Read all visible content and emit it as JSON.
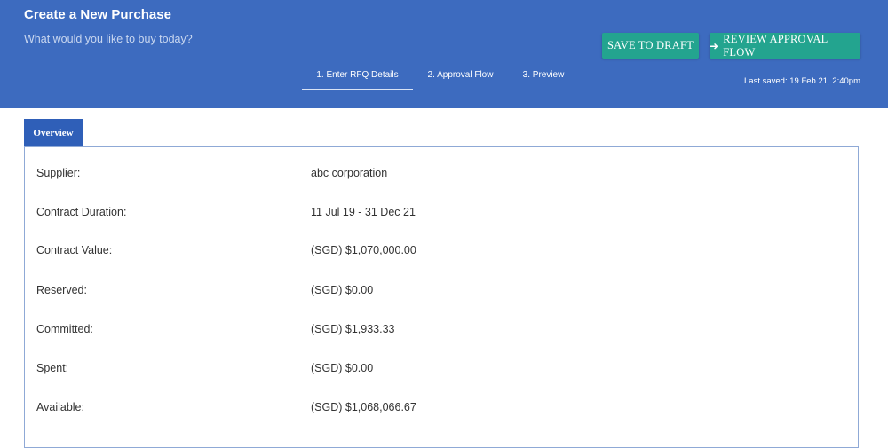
{
  "header": {
    "title": "Create a New Purchase",
    "subtitle": "What would you like to buy today?",
    "save_draft_label": "SAVE TO DRAFT",
    "review_label": "REVIEW APPROVAL FLOW",
    "review_icon": "arrow-right-icon",
    "last_saved": "Last saved: 19 Feb 21, 2:40pm",
    "accent_color": "#3d6bbf",
    "button_color": "#23a48f"
  },
  "steps": [
    {
      "label": "1. Enter RFQ Details",
      "active": true
    },
    {
      "label": "2. Approval Flow",
      "active": false
    },
    {
      "label": "3. Preview",
      "active": false
    }
  ],
  "tabs": {
    "overview": "Overview"
  },
  "overview": {
    "rows": [
      {
        "label": "Supplier:",
        "value": "abc corporation"
      },
      {
        "label": "Contract Duration:",
        "value": "11 Jul 19 - 31 Dec 21"
      },
      {
        "label": "Contract Value:",
        "value": "(SGD) $1,070,000.00"
      },
      {
        "label": "Reserved:",
        "value": "(SGD) $0.00"
      },
      {
        "label": "Committed:",
        "value": "(SGD) $1,933.33"
      },
      {
        "label": "Spent:",
        "value": "(SGD) $0.00"
      },
      {
        "label": "Available:",
        "value": "(SGD) $1,068,066.67"
      }
    ]
  }
}
